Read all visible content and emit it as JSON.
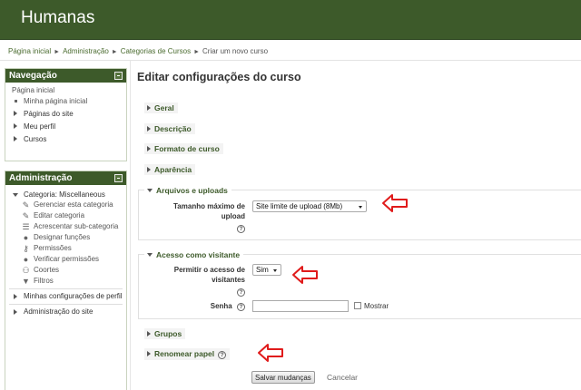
{
  "header": {
    "site_title": "Humanas"
  },
  "breadcrumb": [
    "Página inicial",
    "Administração",
    "Categorias de Cursos",
    "Criar um novo curso"
  ],
  "nav_block": {
    "title": "Navegação",
    "top": "Página inicial",
    "items": [
      {
        "label": "Minha página inicial"
      },
      {
        "label": "Páginas do site"
      },
      {
        "label": "Meu perfil"
      },
      {
        "label": "Cursos"
      }
    ]
  },
  "admin_block": {
    "title": "Administração",
    "category": "Categoria: Miscellaneous",
    "items": [
      {
        "label": "Gerenciar esta categoria",
        "icon": "pencil-icon"
      },
      {
        "label": "Editar categoria",
        "icon": "edit-icon"
      },
      {
        "label": "Acrescentar sub-categoria",
        "icon": "list-icon"
      },
      {
        "label": "Designar funções",
        "icon": "user-icon"
      },
      {
        "label": "Permissões",
        "icon": "key-icon"
      },
      {
        "label": "Verificar permissões",
        "icon": "user-check-icon"
      },
      {
        "label": "Coortes",
        "icon": "group-icon"
      },
      {
        "label": "Filtros",
        "icon": "filter-icon"
      }
    ],
    "my_settings": "Minhas configurações de perfil",
    "site_admin": "Administração do site"
  },
  "main": {
    "heading": "Editar configurações do curso",
    "sections": {
      "geral": "Geral",
      "descricao": "Descrição",
      "formato": "Formato de curso",
      "aparencia": "Aparência",
      "arquivos": "Arquivos e uploads",
      "acesso": "Acesso como visitante",
      "grupos": "Grupos",
      "renomear": "Renomear papel"
    },
    "upload": {
      "label_line1": "Tamanho máximo de",
      "label_line2": "upload",
      "value": "Site limite de upload (8Mb)"
    },
    "guest": {
      "label_line1": "Permitir o acesso de",
      "label_line2": "visitantes",
      "value": "Sim",
      "password_label": "Senha",
      "show_label": "Mostrar"
    },
    "help_glyph": "?",
    "save_label": "Salvar mudanças",
    "cancel_label": "Cancelar"
  },
  "colors": {
    "brand": "#3d5a2a",
    "annotation": "#e01b1b"
  }
}
